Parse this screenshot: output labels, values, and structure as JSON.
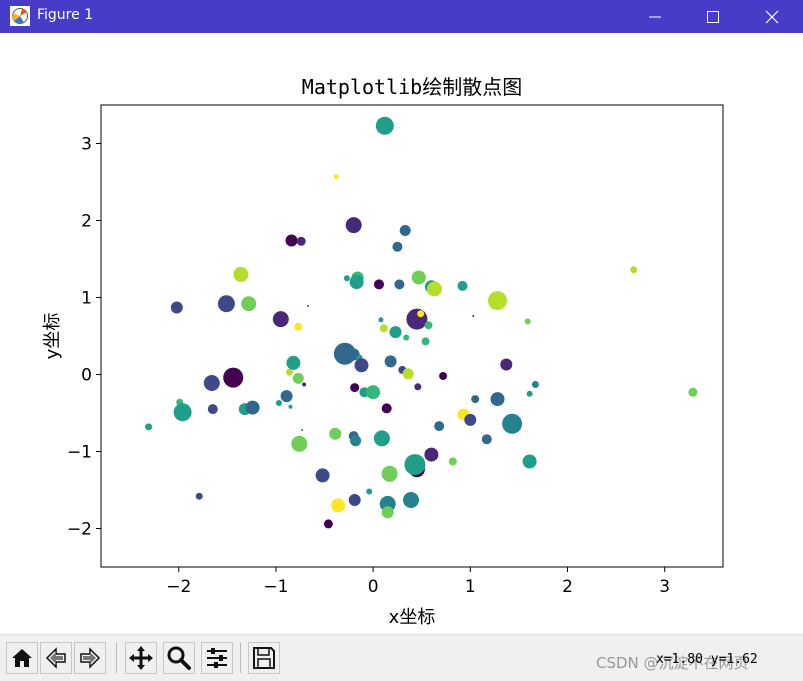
{
  "window": {
    "title": "Figure 1",
    "min_icon": "minimize-icon",
    "max_icon": "maximize-icon",
    "close_icon": "close-icon"
  },
  "toolbar": {
    "buttons": [
      "home-icon",
      "back-icon",
      "forward-icon",
      "pan-icon",
      "zoom-icon",
      "configure-subplots-icon",
      "save-icon"
    ],
    "coords": "x=1.80 y=1.62"
  },
  "watermark": "CSDN @沉淀不在网页",
  "chart_data": {
    "type": "scatter",
    "title": "Matplotlib绘制散点图",
    "xlabel": "x坐标",
    "ylabel": "y坐标",
    "xlim": [
      -2.8,
      3.6
    ],
    "ylim": [
      -2.5,
      3.5
    ],
    "xticks": [
      -2,
      -1,
      0,
      1,
      2,
      3
    ],
    "yticks": [
      -2,
      -1,
      0,
      1,
      2,
      3
    ],
    "xtick_labels": [
      "−2",
      "−1",
      "0",
      "1",
      "2",
      "3"
    ],
    "ytick_labels": [
      "−2",
      "−1",
      "0",
      "1",
      "2",
      "3"
    ],
    "colormap": [
      "#440154",
      "#482878",
      "#3e4989",
      "#31688e",
      "#26828e",
      "#1f9e89",
      "#35b779",
      "#6ece58",
      "#b5de2b",
      "#fde725"
    ],
    "grid": false,
    "points": [
      {
        "x": 0.12,
        "y": 3.23,
        "s": 9,
        "c": 0.55
      },
      {
        "x": -0.38,
        "y": 2.57,
        "s": 2.5,
        "c": 0.95
      },
      {
        "x": -0.2,
        "y": 1.94,
        "s": 8,
        "c": 0.12
      },
      {
        "x": 0.33,
        "y": 1.87,
        "s": 5.5,
        "c": 0.35
      },
      {
        "x": -0.84,
        "y": 1.74,
        "s": 6,
        "c": 0.0
      },
      {
        "x": -0.74,
        "y": 1.73,
        "s": 4.5,
        "c": 0.12
      },
      {
        "x": 0.25,
        "y": 1.66,
        "s": 5,
        "c": 0.3
      },
      {
        "x": -1.36,
        "y": 1.3,
        "s": 7.5,
        "c": 0.93
      },
      {
        "x": -0.16,
        "y": 1.26,
        "s": 6,
        "c": 0.68
      },
      {
        "x": -0.27,
        "y": 1.25,
        "s": 3,
        "c": 0.5
      },
      {
        "x": 0.47,
        "y": 1.26,
        "s": 7,
        "c": 0.75
      },
      {
        "x": -0.17,
        "y": 1.2,
        "s": 7,
        "c": 0.55
      },
      {
        "x": 0.06,
        "y": 1.17,
        "s": 5,
        "c": 0.0
      },
      {
        "x": 0.27,
        "y": 1.17,
        "s": 5,
        "c": 0.35
      },
      {
        "x": 0.6,
        "y": 1.14,
        "s": 6.5,
        "c": 0.6
      },
      {
        "x": 0.63,
        "y": 1.11,
        "s": 7.5,
        "c": 0.92
      },
      {
        "x": 0.92,
        "y": 1.15,
        "s": 5,
        "c": 0.5
      },
      {
        "x": 2.68,
        "y": 1.36,
        "s": 3.5,
        "c": 0.93
      },
      {
        "x": 1.28,
        "y": 0.96,
        "s": 9.5,
        "c": 0.93
      },
      {
        "x": -1.51,
        "y": 0.92,
        "s": 8.5,
        "c": 0.2
      },
      {
        "x": -1.28,
        "y": 0.92,
        "s": 7.5,
        "c": 0.75
      },
      {
        "x": -2.02,
        "y": 0.87,
        "s": 6,
        "c": 0.2
      },
      {
        "x": -0.67,
        "y": 0.89,
        "s": 1,
        "c": 0.2
      },
      {
        "x": -0.95,
        "y": 0.72,
        "s": 8,
        "c": 0.1
      },
      {
        "x": -0.77,
        "y": 0.62,
        "s": 4,
        "c": 0.95
      },
      {
        "x": 0.45,
        "y": 0.72,
        "s": 10.5,
        "c": 0.12
      },
      {
        "x": 0.49,
        "y": 0.79,
        "s": 3.5,
        "c": 0.95
      },
      {
        "x": 1.03,
        "y": 0.76,
        "s": 1,
        "c": 0.12
      },
      {
        "x": 1.59,
        "y": 0.69,
        "s": 3,
        "c": 0.75
      },
      {
        "x": 0.08,
        "y": 0.71,
        "s": 2.5,
        "c": 0.6
      },
      {
        "x": 0.11,
        "y": 0.6,
        "s": 4,
        "c": 0.85
      },
      {
        "x": 0.23,
        "y": 0.55,
        "s": 6,
        "c": 0.5
      },
      {
        "x": 0.57,
        "y": 0.64,
        "s": 4,
        "c": 0.65
      },
      {
        "x": 0.54,
        "y": 0.43,
        "s": 4,
        "c": 0.68
      },
      {
        "x": 0.34,
        "y": 0.48,
        "s": 3,
        "c": 0.65
      },
      {
        "x": -0.29,
        "y": 0.27,
        "s": 11,
        "c": 0.3
      },
      {
        "x": -0.2,
        "y": 0.26,
        "s": 6,
        "c": 0.3
      },
      {
        "x": -0.14,
        "y": 0.22,
        "s": 3,
        "c": 0.55
      },
      {
        "x": -0.12,
        "y": 0.12,
        "s": 7,
        "c": 0.2
      },
      {
        "x": 0.18,
        "y": 0.17,
        "s": 6,
        "c": 0.3
      },
      {
        "x": -0.82,
        "y": 0.15,
        "s": 7,
        "c": 0.6
      },
      {
        "x": 0.3,
        "y": 0.06,
        "s": 4,
        "c": 0.2
      },
      {
        "x": 0.36,
        "y": 0.01,
        "s": 5.5,
        "c": 0.85
      },
      {
        "x": 0.72,
        "y": -0.02,
        "s": 4,
        "c": 0.05
      },
      {
        "x": 1.37,
        "y": 0.13,
        "s": 6,
        "c": 0.12
      },
      {
        "x": -0.86,
        "y": 0.03,
        "s": 3.5,
        "c": 0.9
      },
      {
        "x": -0.77,
        "y": -0.05,
        "s": 5.5,
        "c": 0.8
      },
      {
        "x": -0.71,
        "y": -0.13,
        "s": 2,
        "c": 0.12
      },
      {
        "x": -1.44,
        "y": -0.04,
        "s": 10,
        "c": 0.05
      },
      {
        "x": -1.66,
        "y": -0.11,
        "s": 8,
        "c": 0.2
      },
      {
        "x": -0.19,
        "y": -0.17,
        "s": 4.5,
        "c": 0.05
      },
      {
        "x": -0.09,
        "y": -0.23,
        "s": 5,
        "c": 0.5
      },
      {
        "x": 0.0,
        "y": -0.23,
        "s": 7,
        "c": 0.7
      },
      {
        "x": 0.46,
        "y": -0.16,
        "s": 3.5,
        "c": 0.1
      },
      {
        "x": 1.67,
        "y": -0.13,
        "s": 3.5,
        "c": 0.45
      },
      {
        "x": 1.61,
        "y": -0.25,
        "s": 3,
        "c": 0.6
      },
      {
        "x": 3.29,
        "y": -0.23,
        "s": 4.5,
        "c": 0.75
      },
      {
        "x": -0.89,
        "y": -0.28,
        "s": 6,
        "c": 0.3
      },
      {
        "x": -0.97,
        "y": -0.37,
        "s": 3,
        "c": 0.55
      },
      {
        "x": -0.85,
        "y": -0.42,
        "s": 2,
        "c": 0.55
      },
      {
        "x": -1.99,
        "y": -0.36,
        "s": 3.5,
        "c": 0.65
      },
      {
        "x": -1.65,
        "y": -0.45,
        "s": 5,
        "c": 0.2
      },
      {
        "x": -1.96,
        "y": -0.49,
        "s": 9,
        "c": 0.55
      },
      {
        "x": -1.32,
        "y": -0.45,
        "s": 6,
        "c": 0.6
      },
      {
        "x": -1.24,
        "y": -0.43,
        "s": 7,
        "c": 0.3
      },
      {
        "x": 0.14,
        "y": -0.44,
        "s": 5,
        "c": 0.0
      },
      {
        "x": 1.05,
        "y": -0.32,
        "s": 4,
        "c": 0.3
      },
      {
        "x": 1.28,
        "y": -0.32,
        "s": 7,
        "c": 0.3
      },
      {
        "x": 0.93,
        "y": -0.52,
        "s": 6,
        "c": 0.95
      },
      {
        "x": 1.0,
        "y": -0.59,
        "s": 6,
        "c": 0.2
      },
      {
        "x": 1.43,
        "y": -0.64,
        "s": 10,
        "c": 0.4
      },
      {
        "x": 0.68,
        "y": -0.67,
        "s": 5,
        "c": 0.3
      },
      {
        "x": -2.31,
        "y": -0.68,
        "s": 3.5,
        "c": 0.55
      },
      {
        "x": -0.73,
        "y": -0.72,
        "s": 1,
        "c": 0.35
      },
      {
        "x": -0.39,
        "y": -0.77,
        "s": 6,
        "c": 0.8
      },
      {
        "x": -0.2,
        "y": -0.8,
        "s": 5,
        "c": 0.35
      },
      {
        "x": -0.18,
        "y": -0.86,
        "s": 5.5,
        "c": 0.45
      },
      {
        "x": 0.09,
        "y": -0.83,
        "s": 8,
        "c": 0.6
      },
      {
        "x": 1.17,
        "y": -0.84,
        "s": 5,
        "c": 0.3
      },
      {
        "x": -0.76,
        "y": -0.9,
        "s": 8,
        "c": 0.75
      },
      {
        "x": 0.6,
        "y": -1.04,
        "s": 7,
        "c": 0.1
      },
      {
        "x": 0.45,
        "y": -1.23,
        "s": 8,
        "c": 0.05
      },
      {
        "x": 0.43,
        "y": -1.17,
        "s": 10.5,
        "c": 0.55
      },
      {
        "x": 0.82,
        "y": -1.13,
        "s": 4,
        "c": 0.75
      },
      {
        "x": 1.61,
        "y": -1.13,
        "s": 7,
        "c": 0.55
      },
      {
        "x": 0.17,
        "y": -1.29,
        "s": 8,
        "c": 0.75
      },
      {
        "x": -0.52,
        "y": -1.31,
        "s": 7,
        "c": 0.2
      },
      {
        "x": -1.79,
        "y": -1.58,
        "s": 3.5,
        "c": 0.25
      },
      {
        "x": -0.19,
        "y": -1.63,
        "s": 6,
        "c": 0.2
      },
      {
        "x": -0.04,
        "y": -1.52,
        "s": 3,
        "c": 0.5
      },
      {
        "x": 0.15,
        "y": -1.68,
        "s": 8,
        "c": 0.4
      },
      {
        "x": 0.39,
        "y": -1.63,
        "s": 8,
        "c": 0.4
      },
      {
        "x": -0.36,
        "y": -1.7,
        "s": 7,
        "c": 0.97
      },
      {
        "x": 0.15,
        "y": -1.79,
        "s": 6,
        "c": 0.75
      },
      {
        "x": -0.46,
        "y": -1.94,
        "s": 4.5,
        "c": 0.05
      }
    ]
  }
}
